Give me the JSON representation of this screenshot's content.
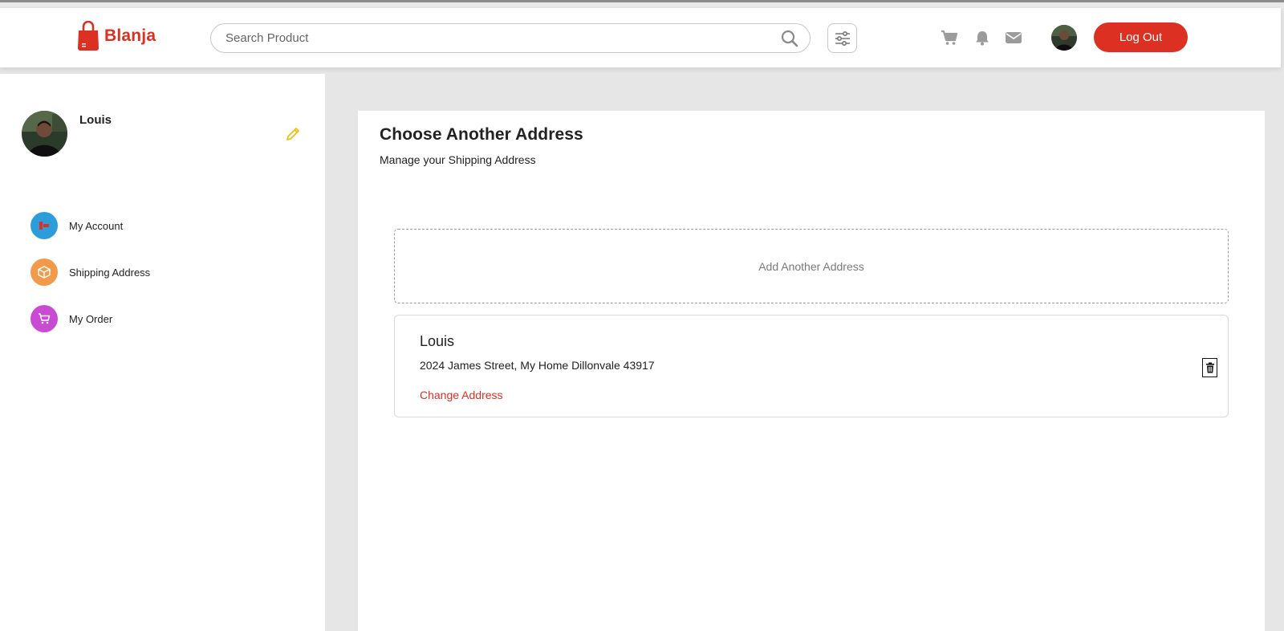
{
  "brand": {
    "name": "Blanja",
    "color": "#db3022"
  },
  "header": {
    "search_placeholder": "Search Product",
    "icons": [
      "search-icon",
      "filter-icon",
      "cart-icon",
      "bell-icon",
      "mail-icon"
    ],
    "logout_label": "Log Out"
  },
  "sidebar": {
    "user_name": "Louis",
    "items": [
      {
        "label": "My Account",
        "icon": "user-icon",
        "color": "#2d9cdb"
      },
      {
        "label": "Shipping Address",
        "icon": "package-icon",
        "color": "#f2994a"
      },
      {
        "label": "My Order",
        "icon": "cart-icon",
        "color": "#c94bd3"
      }
    ]
  },
  "main": {
    "title": "Choose Another Address",
    "subtitle": "Manage your Shipping Address",
    "add_label": "Add Another Address",
    "address": {
      "name": "Louis",
      "text": "2024 James Street, My Home Dillonvale 43917",
      "change_label": "Change Address"
    }
  }
}
